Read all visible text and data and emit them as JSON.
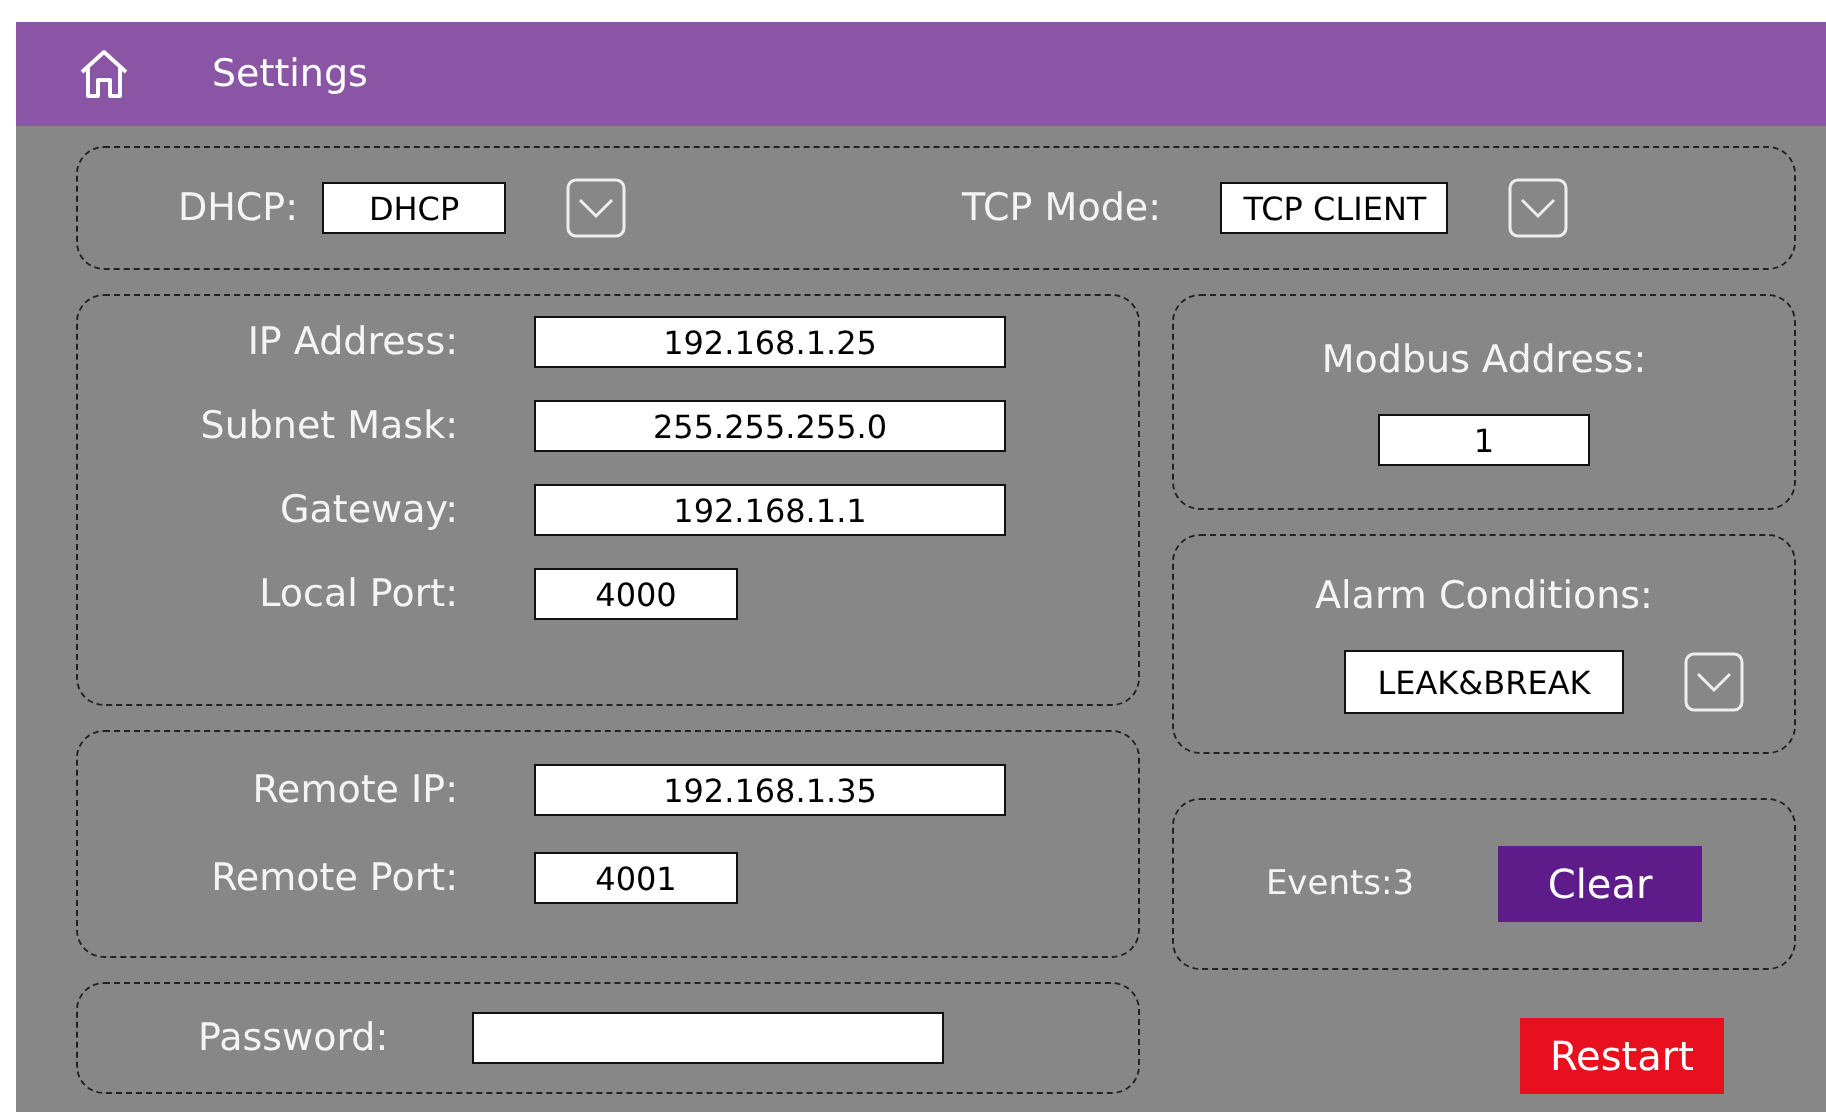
{
  "header": {
    "title": "Settings"
  },
  "mode_row": [
    {
      "label": "DHCP:",
      "value": "DHCP"
    },
    {
      "label": "TCP Mode:",
      "value": "TCP CLIENT"
    }
  ],
  "local_network": [
    {
      "label": "IP Address:",
      "value": "192.168.1.25",
      "kind": "wide"
    },
    {
      "label": "Subnet Mask:",
      "value": "255.255.255.0",
      "kind": "wide"
    },
    {
      "label": "Gateway:",
      "value": "192.168.1.1",
      "kind": "wide"
    },
    {
      "label": "Local Port:",
      "value": "4000",
      "kind": "short"
    }
  ],
  "remote_network": [
    {
      "label": "Remote IP:",
      "value": "192.168.1.35",
      "kind": "wide"
    },
    {
      "label": "Remote Port:",
      "value": "4001",
      "kind": "short"
    }
  ],
  "password": {
    "label": "Password:"
  },
  "modbus": {
    "label": "Modbus Address:",
    "value": "1"
  },
  "alarm": {
    "label": "Alarm Conditions:",
    "value": "LEAK&BREAK"
  },
  "events": {
    "label": "Events:3",
    "button": "Clear"
  },
  "restart_button": "Restart"
}
